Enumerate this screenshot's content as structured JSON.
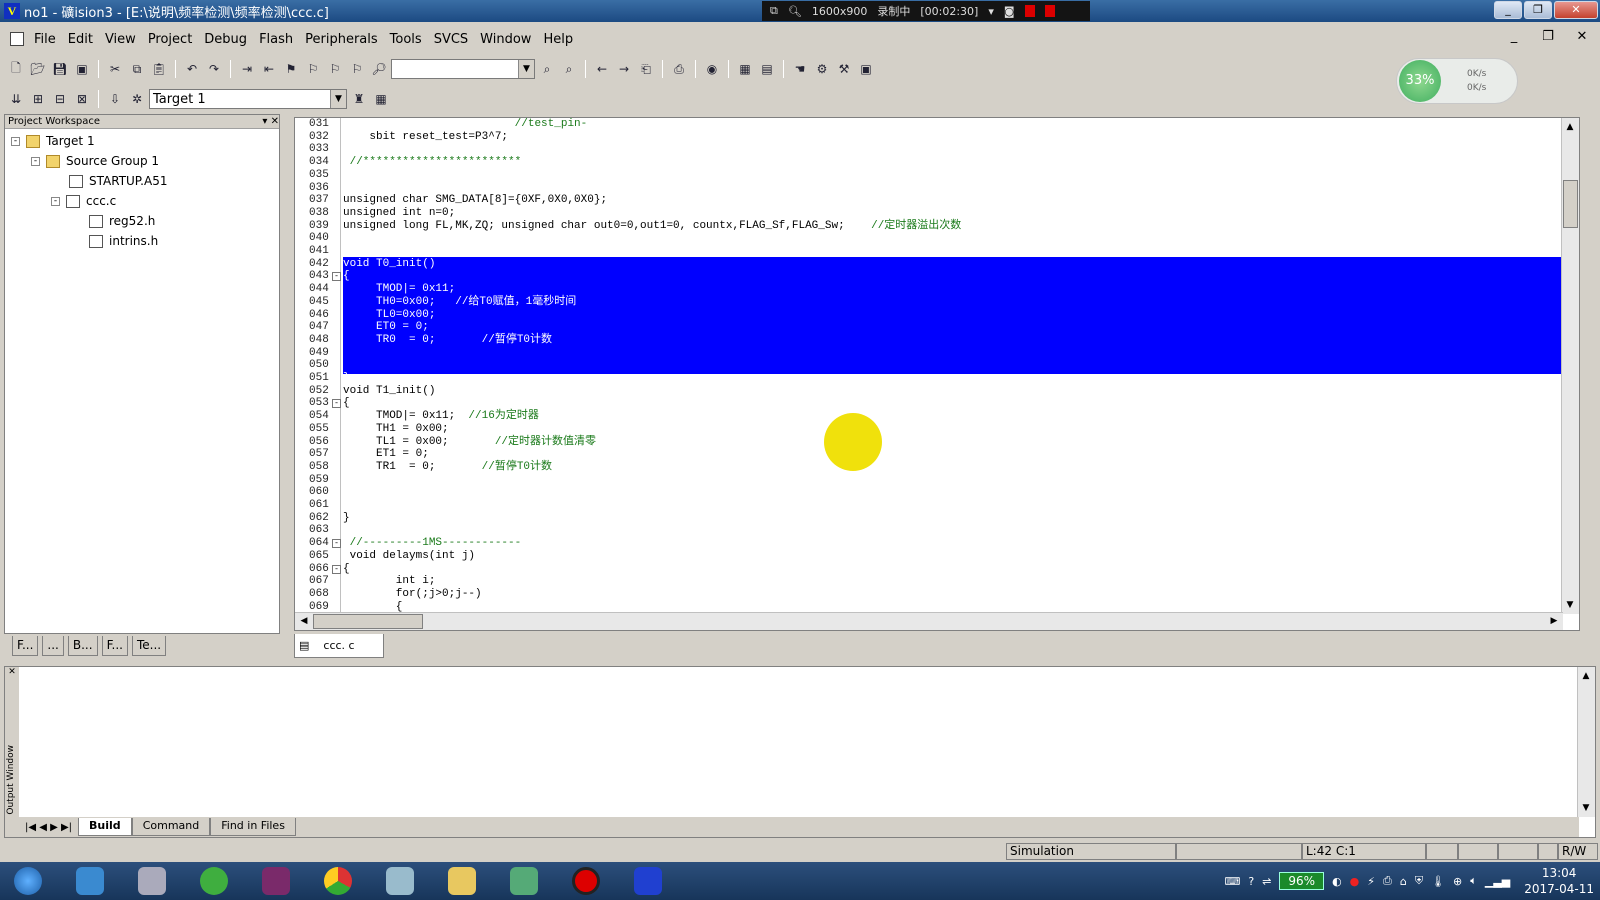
{
  "window": {
    "title": "no1 - 礦ision3 - [E:\\说明\\频率检测\\频率检测\\ccc.c]",
    "controls": [
      "_",
      "❐",
      "✕"
    ]
  },
  "recorder": {
    "resolution": "1600x900",
    "status": "录制中",
    "timer": "[00:02:30]"
  },
  "menu": {
    "items": [
      "File",
      "Edit",
      "View",
      "Project",
      "Debug",
      "Flash",
      "Peripherals",
      "Tools",
      "SVCS",
      "Window",
      "Help"
    ]
  },
  "toolbar": {
    "find_combo_value": "",
    "target_combo_value": "Target 1"
  },
  "network_widget": {
    "percent": "33%",
    "up": "0K/s",
    "down": "0K/s"
  },
  "workspace": {
    "header": "Project Workspace",
    "tree": [
      {
        "label": "Target 1",
        "level": 0,
        "expander": "-",
        "icon": "target-icon"
      },
      {
        "label": "Source Group 1",
        "level": 1,
        "expander": "-",
        "icon": "folder-icon"
      },
      {
        "label": "STARTUP.A51",
        "level": 2,
        "expander": "",
        "icon": "file-icon"
      },
      {
        "label": "ccc.c",
        "level": 2,
        "expander": "-",
        "icon": "file-icon"
      },
      {
        "label": "reg52.h",
        "level": 3,
        "expander": "",
        "icon": "file-icon"
      },
      {
        "label": "intrins.h",
        "level": 3,
        "expander": "",
        "icon": "file-icon"
      }
    ],
    "tabs": [
      "F...",
      "...",
      "B...",
      "F...",
      "Te..."
    ]
  },
  "editor": {
    "tab_label": "ccc. c",
    "lines": [
      {
        "n": "031",
        "code": "                          //test_pin-",
        "fold": ""
      },
      {
        "n": "032",
        "code": "    sbit reset_test=P3^7;",
        "fold": ""
      },
      {
        "n": "033",
        "code": "",
        "fold": ""
      },
      {
        "n": "034",
        "code": " //************************",
        "fold": ""
      },
      {
        "n": "035",
        "code": "",
        "fold": ""
      },
      {
        "n": "036",
        "code": "",
        "fold": ""
      },
      {
        "n": "037",
        "code": "unsigned char SMG_DATA[8]={0XF,0X0,0X0};",
        "fold": ""
      },
      {
        "n": "038",
        "code": "unsigned int n=0;",
        "fold": ""
      },
      {
        "n": "039",
        "code": "unsigned long FL,MK,ZQ; unsigned char out0=0,out1=0, countx,FLAG_Sf,FLAG_Sw;    //定时器溢出次数",
        "fold": ""
      },
      {
        "n": "040",
        "code": "",
        "fold": ""
      },
      {
        "n": "041",
        "code": "",
        "fold": ""
      },
      {
        "n": "042",
        "code": "void T0_init()",
        "fold": "",
        "sel": true
      },
      {
        "n": "043",
        "code": "{",
        "fold": "-",
        "sel": true
      },
      {
        "n": "044",
        "code": "     TMOD|= 0x11;",
        "fold": "",
        "sel": true
      },
      {
        "n": "045",
        "code": "     TH0=0x00;   //给T0赋值，1毫秒时间",
        "fold": "",
        "sel": true
      },
      {
        "n": "046",
        "code": "     TL0=0x00;",
        "fold": "",
        "sel": true
      },
      {
        "n": "047",
        "code": "     ET0 = 0;",
        "fold": "",
        "sel": true
      },
      {
        "n": "048",
        "code": "     TR0  = 0;       //暂停T0计数",
        "fold": "",
        "sel": true
      },
      {
        "n": "049",
        "code": "",
        "fold": "",
        "sel": true
      },
      {
        "n": "050",
        "code": "",
        "fold": "",
        "sel": true
      },
      {
        "n": "051",
        "code": "}",
        "fold": "",
        "sel": true
      },
      {
        "n": "052",
        "code": "void T1_init()",
        "fold": ""
      },
      {
        "n": "053",
        "code": "{",
        "fold": "-"
      },
      {
        "n": "054",
        "code": "     TMOD|= 0x11;  //16为定时器",
        "fold": ""
      },
      {
        "n": "055",
        "code": "     TH1 = 0x00;",
        "fold": ""
      },
      {
        "n": "056",
        "code": "     TL1 = 0x00;       //定时器计数值清零",
        "fold": ""
      },
      {
        "n": "057",
        "code": "     ET1 = 0;",
        "fold": ""
      },
      {
        "n": "058",
        "code": "     TR1  = 0;       //暂停T0计数",
        "fold": ""
      },
      {
        "n": "059",
        "code": "",
        "fold": ""
      },
      {
        "n": "060",
        "code": "",
        "fold": ""
      },
      {
        "n": "061",
        "code": "",
        "fold": ""
      },
      {
        "n": "062",
        "code": "}",
        "fold": ""
      },
      {
        "n": "063",
        "code": "",
        "fold": ""
      },
      {
        "n": "064",
        "code": " //---------1MS------------",
        "fold": "-"
      },
      {
        "n": "065",
        "code": " void delayms(int j)",
        "fold": ""
      },
      {
        "n": "066",
        "code": "{",
        "fold": "-"
      },
      {
        "n": "067",
        "code": "        int i;",
        "fold": ""
      },
      {
        "n": "068",
        "code": "        for(;j>0;j--)",
        "fold": ""
      },
      {
        "n": "069",
        "code": "        {",
        "fold": ""
      }
    ]
  },
  "output": {
    "side_label": "Output Window",
    "tabs": [
      "Build",
      "Command",
      "Find in Files"
    ],
    "active_tab": "Build"
  },
  "status": {
    "mode": "Simulation",
    "position": "L:42 C:1",
    "rw": "R/W"
  },
  "taskbar": {
    "battery": "96%",
    "time": "13:04",
    "date": "2017-04-11"
  },
  "colors": {
    "selection": "#0000ff",
    "comment": "#1a7a1a",
    "cursor_highlight": "#f0e10c"
  }
}
